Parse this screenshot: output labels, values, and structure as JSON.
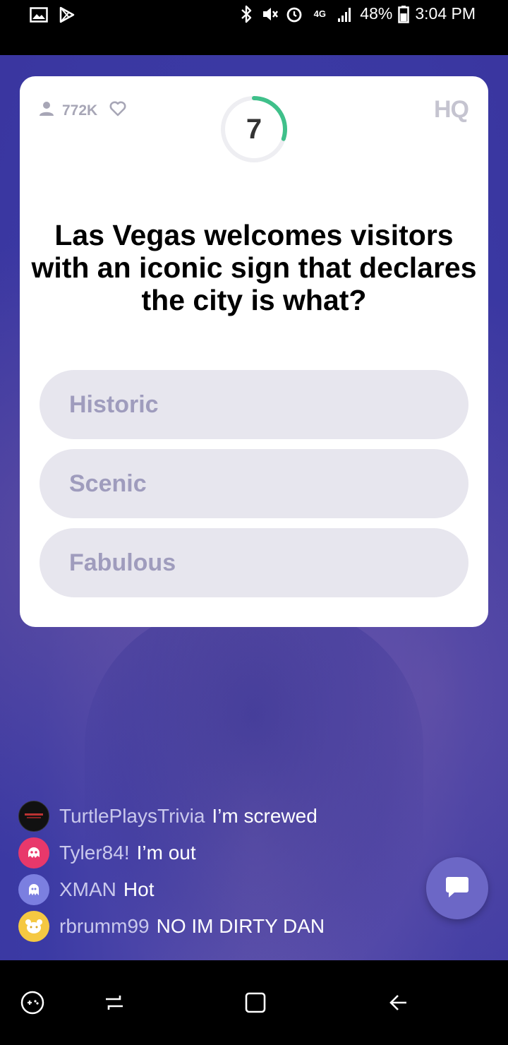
{
  "status_bar": {
    "battery": "48%",
    "time": "3:04 PM",
    "network": "4G",
    "left_icons": [
      "image-icon",
      "play-store-icon"
    ],
    "right_icons": [
      "bluetooth-icon",
      "mute-icon",
      "alarm-icon",
      "lte-icon",
      "signal-icon",
      "battery-icon"
    ]
  },
  "game": {
    "viewers": "772K",
    "timer": "7",
    "timer_fraction": 0.3,
    "logo": "HQ",
    "accent_color": "#3fc08a",
    "question": "Las Vegas welcomes visitors with an iconic sign that declares the city is what?",
    "answers": [
      {
        "label": "Historic"
      },
      {
        "label": "Scenic"
      },
      {
        "label": "Fabulous"
      }
    ]
  },
  "chat": {
    "messages": [
      {
        "user": "TurtlePlaysTrivia",
        "text": "I’m screwed",
        "avatar_color": "#111111"
      },
      {
        "user": "Tyler84!",
        "text": "I’m out",
        "avatar_color": "#e8386b"
      },
      {
        "user": "XMAN",
        "text": "Hot",
        "avatar_color": "#7b7fe0"
      },
      {
        "user": "rbrumm99",
        "text": "NO IM DIRTY DAN",
        "avatar_color": "#f5c842"
      }
    ],
    "button_icon": "chat-bubble-icon"
  },
  "nav_bar": {
    "icons": [
      "game-launcher-icon",
      "recent-apps-icon",
      "home-icon",
      "back-icon"
    ]
  }
}
